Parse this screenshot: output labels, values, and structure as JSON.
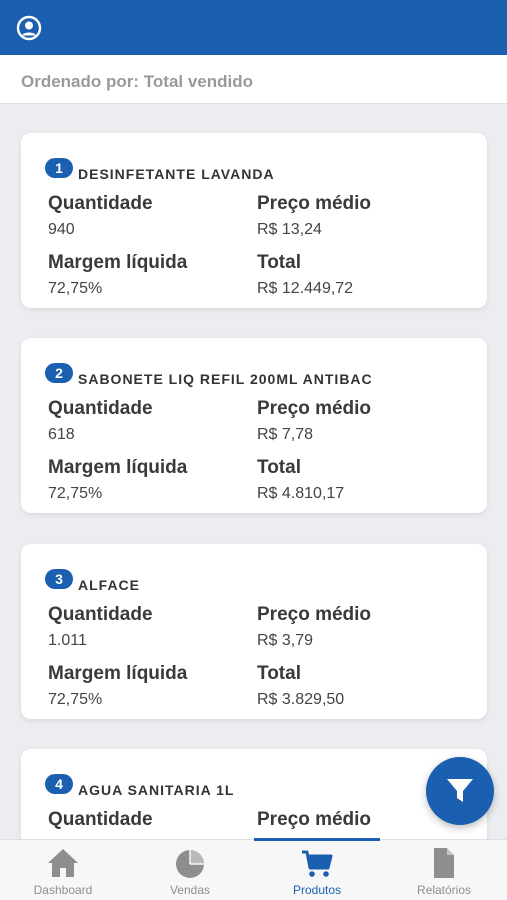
{
  "header": {
    "sort_label": "Ordenado por: Total vendido"
  },
  "labels": {
    "quantity": "Quantidade",
    "avg_price": "Preço médio",
    "net_margin": "Margem líquida",
    "total": "Total"
  },
  "products": [
    {
      "rank": "1",
      "name": "DESINFETANTE LAVANDA",
      "quantity": "940",
      "avg_price": "R$ 13,24",
      "net_margin": "72,75%",
      "total": "R$ 12.449,72"
    },
    {
      "rank": "2",
      "name": "SABONETE LIQ REFIL 200ML ANTIBAC",
      "quantity": "618",
      "avg_price": "R$ 7,78",
      "net_margin": "72,75%",
      "total": "R$ 4.810,17"
    },
    {
      "rank": "3",
      "name": "ALFACE",
      "quantity": "1.011",
      "avg_price": "R$ 3,79",
      "net_margin": "72,75%",
      "total": "R$ 3.829,50"
    },
    {
      "rank": "4",
      "name": "AGUA SANITARIA 1L"
    }
  ],
  "nav": [
    {
      "label": "Dashboard",
      "icon": "home-icon"
    },
    {
      "label": "Vendas",
      "icon": "pie-chart-icon"
    },
    {
      "label": "Produtos",
      "icon": "cart-icon",
      "active": true
    },
    {
      "label": "Relatórios",
      "icon": "document-icon"
    }
  ],
  "colors": {
    "primary": "#1b5fb0",
    "background": "#ebedf0"
  }
}
